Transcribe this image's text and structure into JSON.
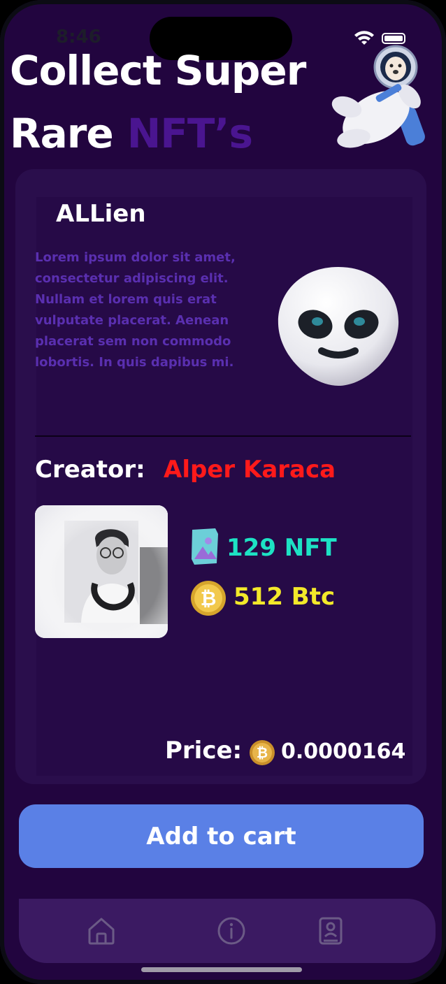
{
  "status_bar": {
    "time": "8:46"
  },
  "header": {
    "line1": "Collect Super",
    "line2": "Rare",
    "accent": "NFT’s"
  },
  "nft": {
    "name": "ALLien",
    "description": "Lorem ipsum dolor sit amet, consectetur adipiscing elit. Nullam et lorem quis erat vulputate placerat. Aenean placerat sem non commodo lobortis. In quis dapibus mi."
  },
  "creator": {
    "label": "Creator:",
    "name": "Alper Karaca",
    "nft_count": "129 NFT",
    "btc_count": "512 Btc"
  },
  "price": {
    "label": "Price:",
    "value": "0.0000164"
  },
  "actions": {
    "add_to_cart": "Add to cart"
  },
  "tabbar": {
    "items": [
      "home-icon",
      "info-icon",
      "contacts-book-icon"
    ]
  },
  "colors": {
    "background": "#22053f",
    "accent_purple": "#4a1590",
    "creator_red": "#ff1a1a",
    "nft_teal": "#1de2c4",
    "btc_yellow": "#f3e92a",
    "button_blue": "#5a80e6"
  }
}
